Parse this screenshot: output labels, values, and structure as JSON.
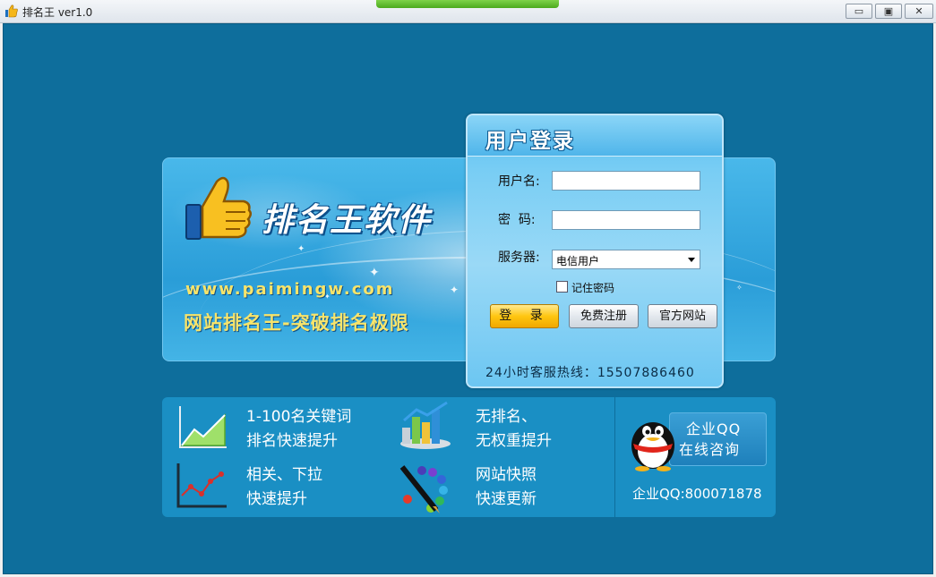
{
  "window": {
    "title": "排名王 ver1.0",
    "min_glyph": "▭",
    "max_glyph": "▣",
    "close_glyph": "✕"
  },
  "banner": {
    "brand_name": "排名王软件",
    "url": "www.paimingw.com",
    "slogan": "网站排名王-突破排名极限"
  },
  "login": {
    "title": "用户登录",
    "username_label": "用户名:",
    "username_value": "",
    "password_label": "密  码:",
    "password_value": "",
    "server_label": "服务器:",
    "server_value": "电信用户",
    "remember_label": "记住密码",
    "remember_checked": false,
    "login_button": "登 录",
    "register_button": "免费注册",
    "website_button": "官方网站",
    "hotline": "24小时客服热线：15507886460"
  },
  "features": [
    {
      "icon": "growth-chart-icon",
      "line1": "1-100名关键词",
      "line2": "排名快速提升"
    },
    {
      "icon": "bar-chart-icon",
      "line1": "无排名、",
      "line2": "无权重提升"
    },
    {
      "icon": "line-chart-icon",
      "line1": "相关、下拉",
      "line2": "快速提升"
    },
    {
      "icon": "pen-palette-icon",
      "line1": "网站快照",
      "line2": "快速更新"
    }
  ],
  "qq": {
    "card_line1": "企业QQ",
    "card_line2": "在线咨询",
    "number": "企业QQ:800071878"
  },
  "colors": {
    "background": "#0e6e9c",
    "banner": "#2a9dd8",
    "accent_yellow": "#f8e46a",
    "login_button": "#ffc611"
  }
}
